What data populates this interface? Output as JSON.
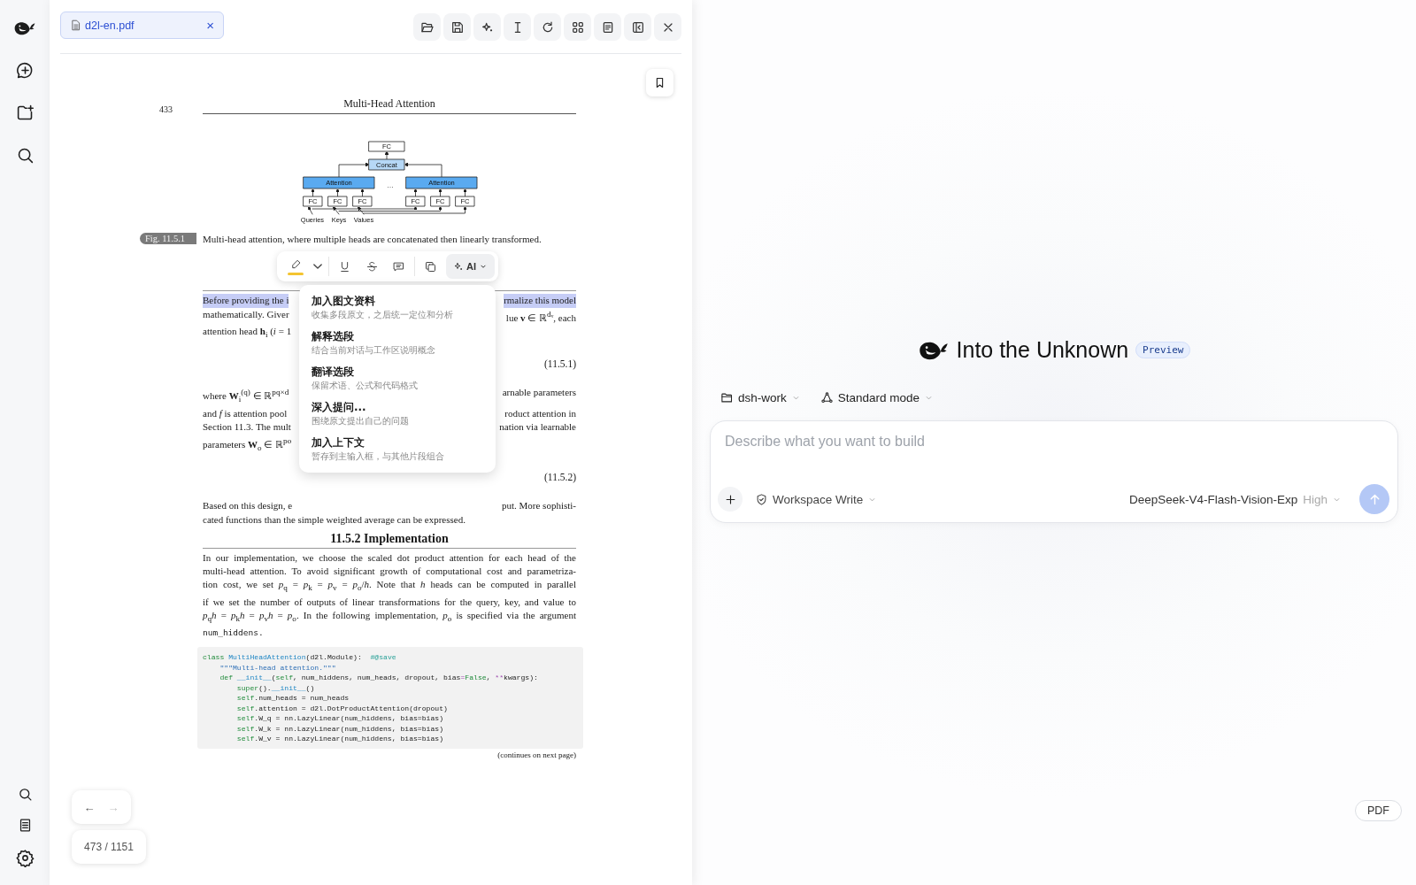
{
  "pdf_viewer": {
    "tab": {
      "filename": "d2l-en.pdf",
      "close": "×"
    },
    "page": {
      "number": "433",
      "running_title": "Multi-Head Attention",
      "figure": {
        "output": "FC",
        "concat": "Concat",
        "ellipsis": "…",
        "heads": [
          {
            "label": "Attention",
            "inputs": [
              "FC",
              "FC",
              "FC"
            ]
          },
          {
            "label": "Attention",
            "inputs": [
              "FC",
              "FC",
              "FC"
            ]
          }
        ],
        "sources": [
          "Queries",
          "Keys",
          "Values"
        ]
      },
      "caption": {
        "tag": "Fig. 11.5.1",
        "text": "Multi-head attention, where multiple heads are concatenated then linearly transformed."
      },
      "blocks": [
        {
          "kind": "split",
          "left": "Before providing the i",
          "right": "rmalize this model",
          "highlighted": true
        },
        {
          "kind": "split",
          "left": "mathematically.  Giver",
          "right": "lue **v** ∈ ℝ$^{dᵥ}$, each",
          "highlighted": false
        },
        {
          "kind": "split",
          "left": "attention head **h**$_{i}$ (*i* = 1",
          "highlighted": false
        },
        {
          "kind": "eq",
          "number": "(11.5.1)"
        },
        {
          "kind": "split",
          "left": "where **W**$_{i}$$^{(q)}$ ∈ ℝ$^{pq×d}$",
          "right": "arnable parameters",
          "highlighted": false
        },
        {
          "kind": "split",
          "left": "and *f* is attention pool",
          "right": "roduct attention in",
          "highlighted": false
        },
        {
          "kind": "split",
          "left": "Section 11.3. The mult",
          "right": "nation via learnable",
          "highlighted": false
        },
        {
          "kind": "split",
          "left": "parameters **W**$_{o}$ ∈ ℝ$^{po}$",
          "highlighted": false
        },
        {
          "kind": "eq",
          "number": "(11.5.2)"
        },
        {
          "kind": "split",
          "left": "Based on this design, e",
          "right": "put. More sophisti-",
          "highlighted": false
        },
        {
          "kind": "line",
          "text": "cated functions than the simple weighted average can be expressed."
        },
        {
          "kind": "heading",
          "text": "11.5.2  Implementation"
        },
        {
          "kind": "justified",
          "text": "In our implementation, we choose the scaled dot product attention for each head of the"
        },
        {
          "kind": "justified",
          "text": "multi-head attention. To avoid significant growth of computational cost and parametriza-"
        },
        {
          "kind": "justified",
          "text": "tion cost, we set *p*$_{q}$ = *p*$_{k}$ = *p*$_{v}$ = *p*$_{o}$/*h*. Note that *h* heads can be computed in parallel"
        },
        {
          "kind": "justified",
          "text": "if we set the number of outputs of linear transformations for the query, key, and value to"
        },
        {
          "kind": "justified",
          "text": "*p*$_{q}$*h* = *p*$_{k}$*h* = *p*$_{v}$*h* = *p*$_{o}$. In the following implementation, *p*$_{o}$ is specified via the argument"
        },
        {
          "kind": "mono",
          "text": "num_hiddens."
        },
        {
          "kind": "code",
          "lines": [
            {
              "tokens": [
                {
                  "kind": "kw",
                  "text": "class"
                },
                {
                  "kind": "name",
                  "text": " MultiHeadAttention"
                },
                {
                  "kind": "plain",
                  "text": "(d2l.Module):  "
                },
                {
                  "kind": "cm",
                  "text": "#@save"
                }
              ],
              "children": [
                {
                  "tokens": [
                    {
                      "kind": "str",
                      "text": "\"\"\"Multi-head attention.\"\"\""
                    }
                  ]
                },
                {
                  "tokens": [
                    {
                      "kind": "kw",
                      "text": "def"
                    },
                    {
                      "kind": "name",
                      "text": " __init__"
                    },
                    {
                      "kind": "plain",
                      "text": "("
                    },
                    {
                      "kind": "kw",
                      "text": "self"
                    },
                    {
                      "kind": "plain",
                      "text": ", num_hiddens, num_heads, dropout, bias"
                    },
                    {
                      "kind": "op",
                      "text": "="
                    },
                    {
                      "kind": "kw",
                      "text": "False"
                    },
                    {
                      "kind": "plain",
                      "text": ", "
                    },
                    {
                      "kind": "op",
                      "text": "**"
                    },
                    {
                      "kind": "plain",
                      "text": "kwargs):"
                    }
                  ],
                  "children": [
                    {
                      "tokens": [
                        {
                          "kind": "kw",
                          "text": "super"
                        },
                        {
                          "kind": "plain",
                          "text": "()."
                        },
                        {
                          "kind": "name",
                          "text": "__init__"
                        },
                        {
                          "kind": "plain",
                          "text": "()"
                        }
                      ]
                    },
                    {
                      "tokens": [
                        {
                          "kind": "kw",
                          "text": "self"
                        },
                        {
                          "kind": "plain",
                          "text": ".num_heads = num_heads"
                        }
                      ]
                    },
                    {
                      "tokens": [
                        {
                          "kind": "kw",
                          "text": "self"
                        },
                        {
                          "kind": "plain",
                          "text": ".attention = d2l.DotProductAttention(dropout)"
                        }
                      ]
                    },
                    {
                      "tokens": [
                        {
                          "kind": "kw",
                          "text": "self"
                        },
                        {
                          "kind": "plain",
                          "text": ".W_q = nn.LazyLinear(num_hiddens, bias=bias)"
                        }
                      ]
                    },
                    {
                      "tokens": [
                        {
                          "kind": "kw",
                          "text": "self"
                        },
                        {
                          "kind": "plain",
                          "text": ".W_k = nn.LazyLinear(num_hiddens, bias=bias)"
                        }
                      ]
                    },
                    {
                      "tokens": [
                        {
                          "kind": "kw",
                          "text": "self"
                        },
                        {
                          "kind": "plain",
                          "text": ".W_v = nn.LazyLinear(num_hiddens, bias=bias)"
                        }
                      ]
                    }
                  ]
                }
              ]
            }
          ]
        },
        {
          "kind": "note",
          "text": "(continues on next page)"
        }
      ]
    },
    "selection_toolbar": {
      "ai_button": {
        "label": "AI",
        "selected": true
      }
    },
    "ai_menu": [
      {
        "title": "加入图文资料",
        "description": "收集多段原文，之后统一定位和分析"
      },
      {
        "title": "解释选段",
        "description": "结合当前对话与工作区说明概念"
      },
      {
        "title": "翻译选段",
        "description": "保留术语、公式和代码格式"
      },
      {
        "title": "深入提问...",
        "description": "围绕原文提出自己的问题"
      },
      {
        "title": "加入上下文",
        "description": "暂存到主输入框，与其他片段组合"
      }
    ],
    "nav": [
      {
        "label": "←",
        "disabled": false
      },
      {
        "label": "→",
        "disabled": true
      }
    ],
    "page_indicator": "473 / 1151"
  },
  "workspace": {
    "title": "Into the Unknown",
    "badge": "Preview",
    "folder": "dsh-work",
    "mode": "Standard mode",
    "prompt": {
      "placeholder": "Describe what you want to build"
    },
    "permission": "Workspace Write",
    "model": "DeepSeek-V4-Flash-Vision-Exp",
    "effort": "High",
    "send_button": {
      "disabled": true
    },
    "pdf_button": "PDF"
  }
}
